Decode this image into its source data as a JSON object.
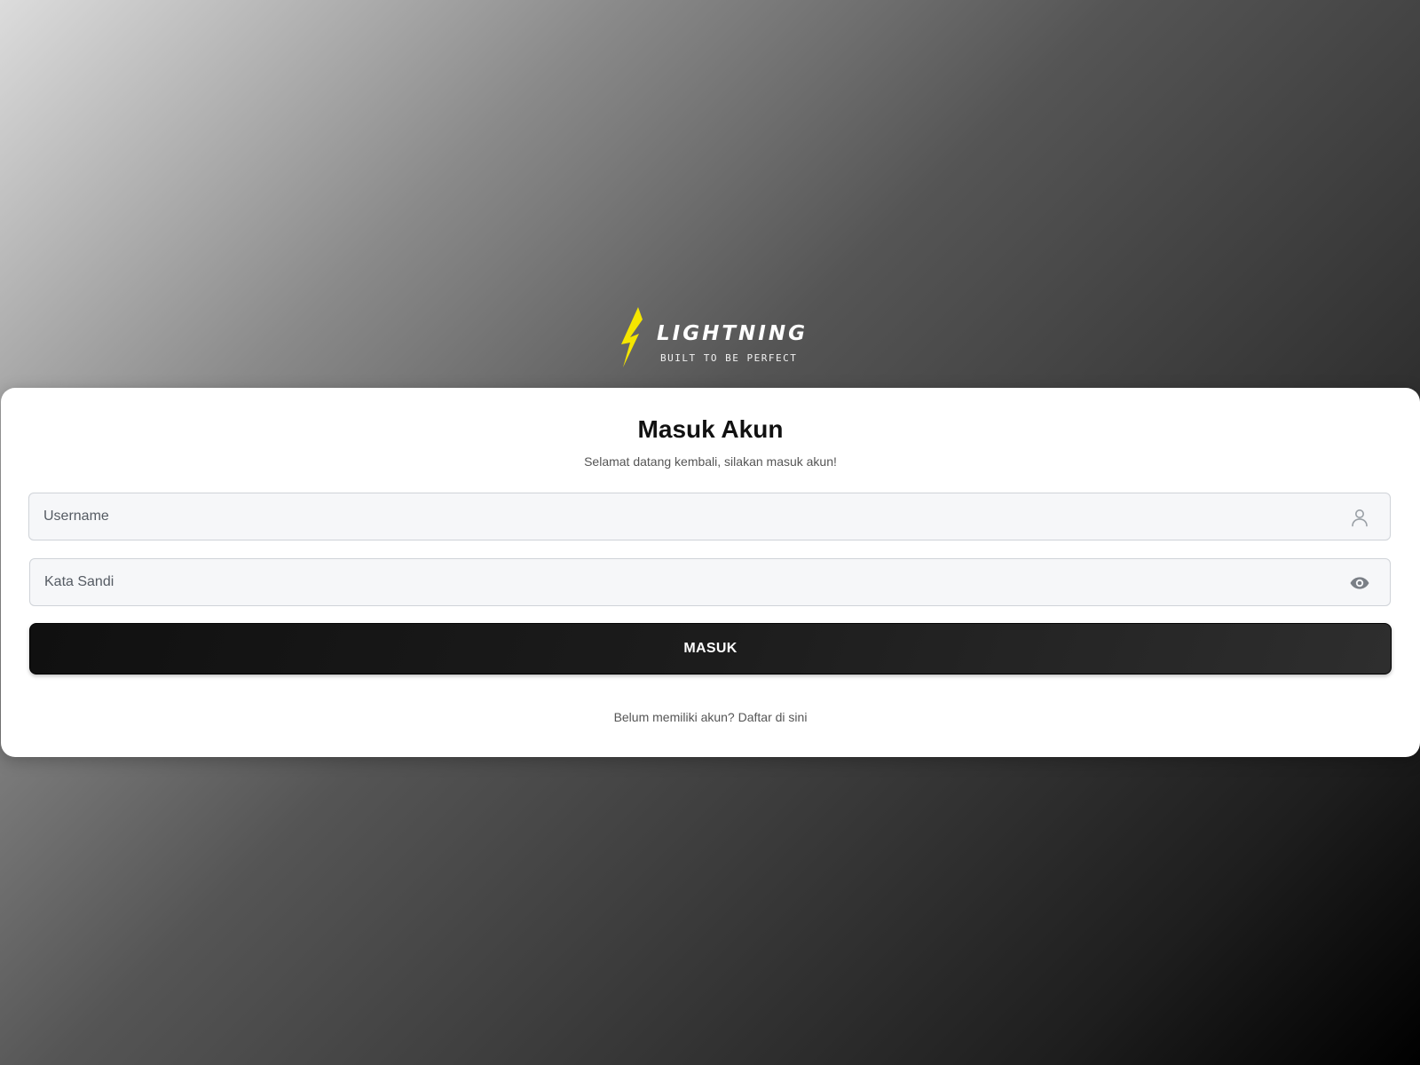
{
  "brand": {
    "name": "LIGHTNING",
    "tagline": "BUILT TO BE PERFECT",
    "logo_icon": "lightning-bolt-icon",
    "accent_color": "#f5e600"
  },
  "login": {
    "title": "Masuk Akun",
    "subtitle": "Selamat datang kembali, silakan masuk akun!",
    "username": {
      "value": "",
      "placeholder": "Username",
      "icon": "user-icon"
    },
    "password": {
      "value": "",
      "placeholder": "Kata Sandi",
      "icon": "eye-icon"
    },
    "submit_label": "MASUK",
    "register_prompt": "Belum memiliki akun?",
    "register_link": "Daftar di sini"
  }
}
